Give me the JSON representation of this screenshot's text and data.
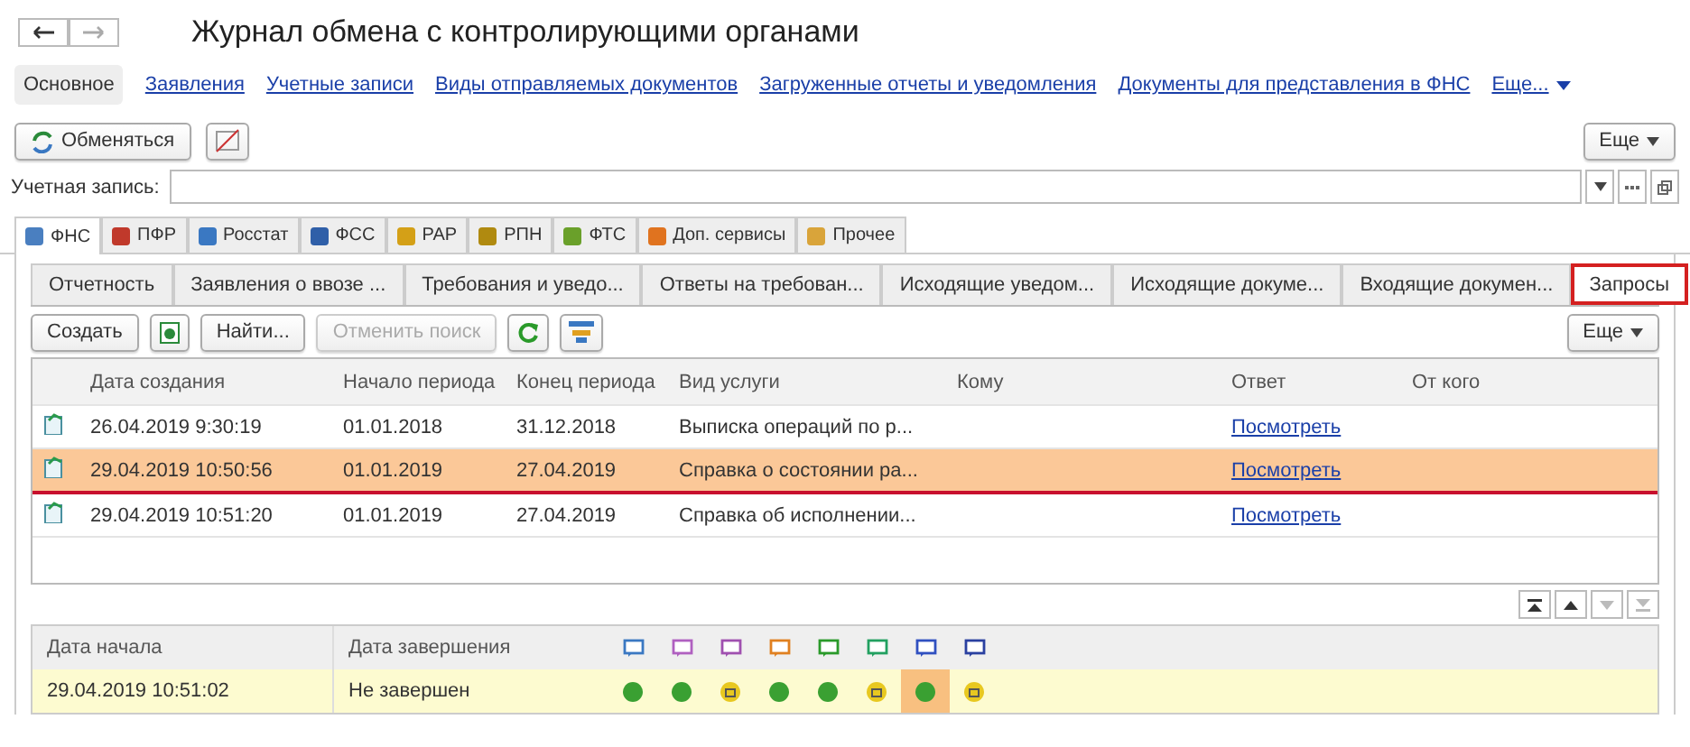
{
  "window": {
    "title": "Журнал обмена с контролирующими органами"
  },
  "nav": [
    {
      "label": "Основное",
      "selected": true
    },
    {
      "label": "Заявления",
      "selected": false
    },
    {
      "label": "Учетные записи",
      "selected": false
    },
    {
      "label": "Виды отправляемых документов",
      "selected": false
    },
    {
      "label": "Загруженные отчеты и уведомления",
      "selected": false
    },
    {
      "label": "Документы для представления в ФНС",
      "selected": false
    },
    {
      "label": "Еще...",
      "selected": false
    }
  ],
  "toolbar": {
    "exchange": "Обменяться",
    "more": "Еще"
  },
  "account": {
    "label": "Учетная запись:"
  },
  "agency_tabs": [
    {
      "label": "ФНС",
      "selected": true,
      "color": "#4a7fc0"
    },
    {
      "label": "ПФР",
      "selected": false,
      "color": "#c0392b"
    },
    {
      "label": "Росстат",
      "selected": false,
      "color": "#3a78c2"
    },
    {
      "label": "ФСС",
      "selected": false,
      "color": "#2f5fa8"
    },
    {
      "label": "РАР",
      "selected": false,
      "color": "#d4a017"
    },
    {
      "label": "РПН",
      "selected": false,
      "color": "#b08a10"
    },
    {
      "label": "ФТС",
      "selected": false,
      "color": "#6aa02a"
    },
    {
      "label": "Доп. сервисы",
      "selected": false,
      "color": "#e0731f"
    },
    {
      "label": "Прочее",
      "selected": false,
      "color": "#d9a43a"
    }
  ],
  "doc_tabs": [
    {
      "label": "Отчетность",
      "selected": false
    },
    {
      "label": "Заявления о ввозе ...",
      "selected": false
    },
    {
      "label": "Требования и уведо...",
      "selected": false
    },
    {
      "label": "Ответы на требован...",
      "selected": false
    },
    {
      "label": "Исходящие уведом...",
      "selected": false
    },
    {
      "label": "Исходящие докуме...",
      "selected": false
    },
    {
      "label": "Входящие докумен...",
      "selected": false
    },
    {
      "label": "Запросы",
      "selected": true
    }
  ],
  "list_toolbar": {
    "create": "Создать",
    "find": "Найти...",
    "cancel_search": "Отменить поиск",
    "cancel_disabled": true,
    "more": "Еще"
  },
  "table": {
    "columns": [
      "Дата создания",
      "Начало периода",
      "Конец периода",
      "Вид услуги",
      "Кому",
      "Ответ",
      "От кого"
    ],
    "rows": [
      {
        "created": "26.04.2019 9:30:19",
        "start": "01.01.2018",
        "end": "31.12.2018",
        "service": "Выписка операций по р...",
        "answer": "Посмотреть",
        "selected": false
      },
      {
        "created": "29.04.2019 10:50:56",
        "start": "01.01.2019",
        "end": "27.04.2019",
        "service": "Справка о состоянии ра...",
        "answer": "Посмотреть",
        "selected": true
      },
      {
        "created": "29.04.2019 10:51:20",
        "start": "01.01.2019",
        "end": "27.04.2019",
        "service": "Справка об исполнении...",
        "answer": "Посмотреть",
        "selected": false
      }
    ]
  },
  "stages": {
    "columns": [
      "Дата начала",
      "Дата завершения"
    ],
    "stage_icons": [
      {
        "color": "#3a78c2"
      },
      {
        "color": "#b060c0"
      },
      {
        "color": "#a050b0"
      },
      {
        "color": "#e08020"
      },
      {
        "color": "#2a9a2a"
      },
      {
        "color": "#22a060"
      },
      {
        "color": "#3050c0"
      },
      {
        "color": "#2a40a0"
      }
    ],
    "rows": [
      {
        "start": "29.04.2019 10:51:02",
        "end": "Не завершен",
        "steps": [
          {
            "kind": "done",
            "selected": false
          },
          {
            "kind": "done",
            "selected": false
          },
          {
            "kind": "waiting",
            "selected": false
          },
          {
            "kind": "done",
            "selected": false
          },
          {
            "kind": "done",
            "selected": false
          },
          {
            "kind": "waiting",
            "selected": false
          },
          {
            "kind": "done",
            "selected": true
          },
          {
            "kind": "waiting",
            "selected": false
          }
        ]
      }
    ]
  }
}
